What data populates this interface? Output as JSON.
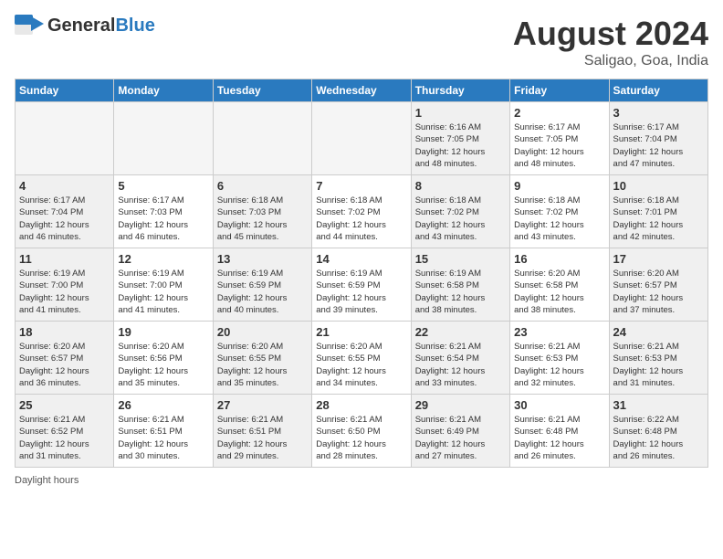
{
  "header": {
    "logo_general": "General",
    "logo_blue": "Blue",
    "month_title": "August 2024",
    "location": "Saligao, Goa, India"
  },
  "days_of_week": [
    "Sunday",
    "Monday",
    "Tuesday",
    "Wednesday",
    "Thursday",
    "Friday",
    "Saturday"
  ],
  "footer_text": "Daylight hours",
  "weeks": [
    [
      {
        "day": "",
        "info": ""
      },
      {
        "day": "",
        "info": ""
      },
      {
        "day": "",
        "info": ""
      },
      {
        "day": "",
        "info": ""
      },
      {
        "day": "1",
        "info": "Sunrise: 6:16 AM\nSunset: 7:05 PM\nDaylight: 12 hours\nand 48 minutes."
      },
      {
        "day": "2",
        "info": "Sunrise: 6:17 AM\nSunset: 7:05 PM\nDaylight: 12 hours\nand 48 minutes."
      },
      {
        "day": "3",
        "info": "Sunrise: 6:17 AM\nSunset: 7:04 PM\nDaylight: 12 hours\nand 47 minutes."
      }
    ],
    [
      {
        "day": "4",
        "info": "Sunrise: 6:17 AM\nSunset: 7:04 PM\nDaylight: 12 hours\nand 46 minutes."
      },
      {
        "day": "5",
        "info": "Sunrise: 6:17 AM\nSunset: 7:03 PM\nDaylight: 12 hours\nand 46 minutes."
      },
      {
        "day": "6",
        "info": "Sunrise: 6:18 AM\nSunset: 7:03 PM\nDaylight: 12 hours\nand 45 minutes."
      },
      {
        "day": "7",
        "info": "Sunrise: 6:18 AM\nSunset: 7:02 PM\nDaylight: 12 hours\nand 44 minutes."
      },
      {
        "day": "8",
        "info": "Sunrise: 6:18 AM\nSunset: 7:02 PM\nDaylight: 12 hours\nand 43 minutes."
      },
      {
        "day": "9",
        "info": "Sunrise: 6:18 AM\nSunset: 7:02 PM\nDaylight: 12 hours\nand 43 minutes."
      },
      {
        "day": "10",
        "info": "Sunrise: 6:18 AM\nSunset: 7:01 PM\nDaylight: 12 hours\nand 42 minutes."
      }
    ],
    [
      {
        "day": "11",
        "info": "Sunrise: 6:19 AM\nSunset: 7:00 PM\nDaylight: 12 hours\nand 41 minutes."
      },
      {
        "day": "12",
        "info": "Sunrise: 6:19 AM\nSunset: 7:00 PM\nDaylight: 12 hours\nand 41 minutes."
      },
      {
        "day": "13",
        "info": "Sunrise: 6:19 AM\nSunset: 6:59 PM\nDaylight: 12 hours\nand 40 minutes."
      },
      {
        "day": "14",
        "info": "Sunrise: 6:19 AM\nSunset: 6:59 PM\nDaylight: 12 hours\nand 39 minutes."
      },
      {
        "day": "15",
        "info": "Sunrise: 6:19 AM\nSunset: 6:58 PM\nDaylight: 12 hours\nand 38 minutes."
      },
      {
        "day": "16",
        "info": "Sunrise: 6:20 AM\nSunset: 6:58 PM\nDaylight: 12 hours\nand 38 minutes."
      },
      {
        "day": "17",
        "info": "Sunrise: 6:20 AM\nSunset: 6:57 PM\nDaylight: 12 hours\nand 37 minutes."
      }
    ],
    [
      {
        "day": "18",
        "info": "Sunrise: 6:20 AM\nSunset: 6:57 PM\nDaylight: 12 hours\nand 36 minutes."
      },
      {
        "day": "19",
        "info": "Sunrise: 6:20 AM\nSunset: 6:56 PM\nDaylight: 12 hours\nand 35 minutes."
      },
      {
        "day": "20",
        "info": "Sunrise: 6:20 AM\nSunset: 6:55 PM\nDaylight: 12 hours\nand 35 minutes."
      },
      {
        "day": "21",
        "info": "Sunrise: 6:20 AM\nSunset: 6:55 PM\nDaylight: 12 hours\nand 34 minutes."
      },
      {
        "day": "22",
        "info": "Sunrise: 6:21 AM\nSunset: 6:54 PM\nDaylight: 12 hours\nand 33 minutes."
      },
      {
        "day": "23",
        "info": "Sunrise: 6:21 AM\nSunset: 6:53 PM\nDaylight: 12 hours\nand 32 minutes."
      },
      {
        "day": "24",
        "info": "Sunrise: 6:21 AM\nSunset: 6:53 PM\nDaylight: 12 hours\nand 31 minutes."
      }
    ],
    [
      {
        "day": "25",
        "info": "Sunrise: 6:21 AM\nSunset: 6:52 PM\nDaylight: 12 hours\nand 31 minutes."
      },
      {
        "day": "26",
        "info": "Sunrise: 6:21 AM\nSunset: 6:51 PM\nDaylight: 12 hours\nand 30 minutes."
      },
      {
        "day": "27",
        "info": "Sunrise: 6:21 AM\nSunset: 6:51 PM\nDaylight: 12 hours\nand 29 minutes."
      },
      {
        "day": "28",
        "info": "Sunrise: 6:21 AM\nSunset: 6:50 PM\nDaylight: 12 hours\nand 28 minutes."
      },
      {
        "day": "29",
        "info": "Sunrise: 6:21 AM\nSunset: 6:49 PM\nDaylight: 12 hours\nand 27 minutes."
      },
      {
        "day": "30",
        "info": "Sunrise: 6:21 AM\nSunset: 6:48 PM\nDaylight: 12 hours\nand 26 minutes."
      },
      {
        "day": "31",
        "info": "Sunrise: 6:22 AM\nSunset: 6:48 PM\nDaylight: 12 hours\nand 26 minutes."
      }
    ]
  ]
}
